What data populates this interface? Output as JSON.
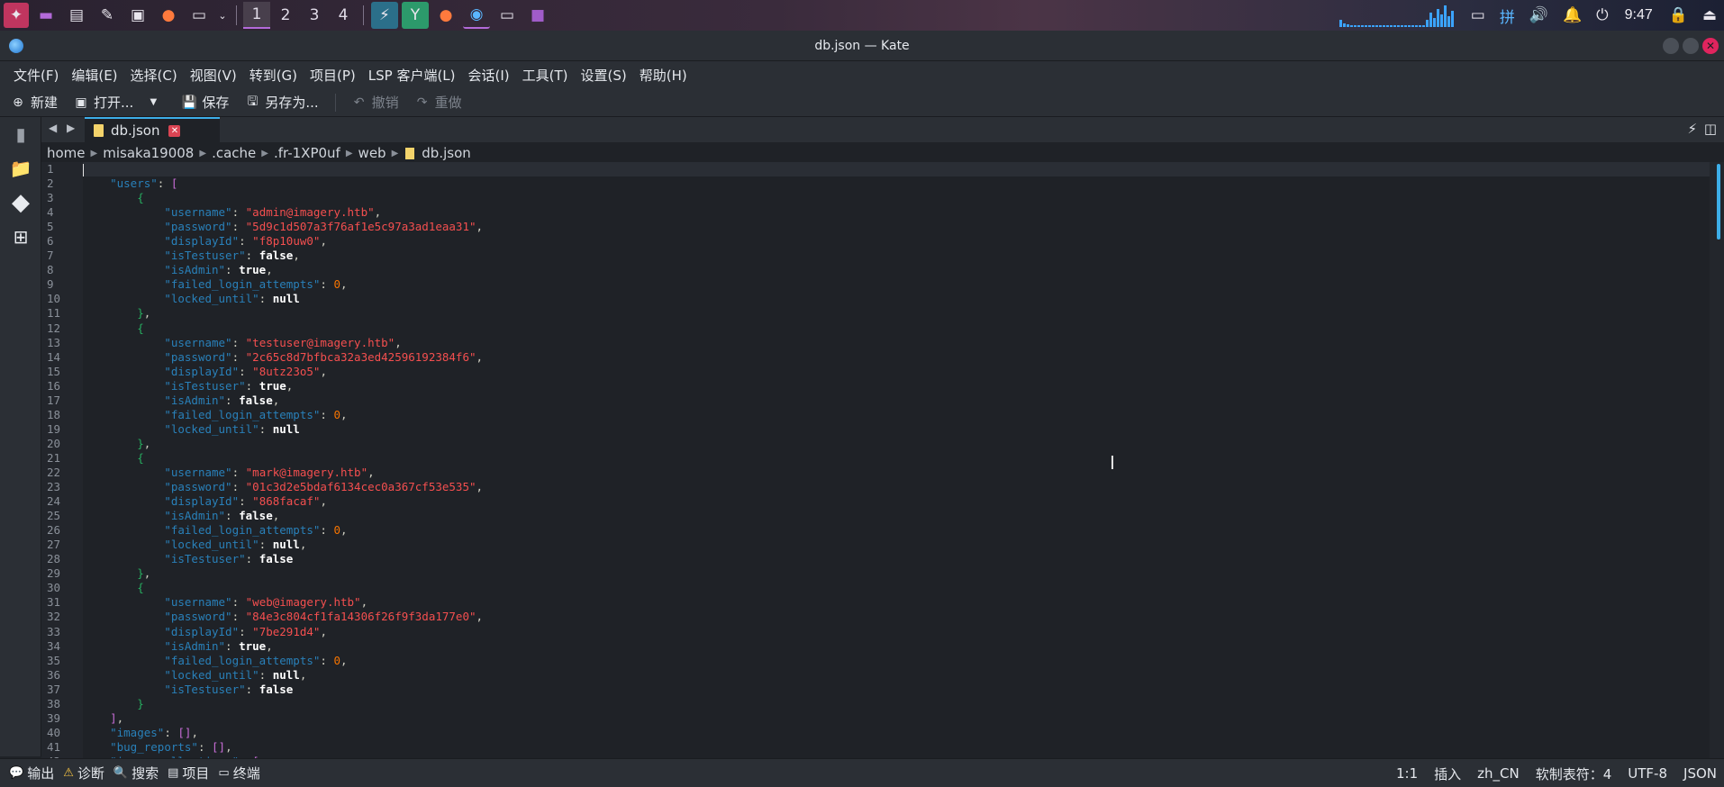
{
  "taskbar": {
    "workspaces": [
      "1",
      "2",
      "3",
      "4"
    ],
    "clock": "9:47",
    "accent": "#b36ad9"
  },
  "window": {
    "title": "db.json — Kate"
  },
  "menu": {
    "items": [
      "文件(F)",
      "编辑(E)",
      "选择(C)",
      "视图(V)",
      "转到(G)",
      "项目(P)",
      "LSP 客户端(L)",
      "会话(I)",
      "工具(T)",
      "设置(S)",
      "帮助(H)"
    ]
  },
  "toolbar": {
    "new_label": "新建",
    "open_label": "打开...",
    "save_label": "保存",
    "saveas_label": "另存为...",
    "undo_label": "撤销",
    "redo_label": "重做"
  },
  "tab": {
    "label": "db.json"
  },
  "breadcrumb": {
    "parts": [
      "home",
      "misaka19008",
      ".cache",
      ".fr-1XP0uf",
      "web"
    ],
    "file": "db.json"
  },
  "editor": {
    "users": [
      {
        "username": "admin@imagery.htb",
        "password": "5d9c1d507a3f76af1e5c97a3ad1eaa31",
        "displayId": "f8p10uw0",
        "isTestuser": "false",
        "isAdmin": "true",
        "failed_login_attempts": "0",
        "locked_until": "null"
      },
      {
        "username": "testuser@imagery.htb",
        "password": "2c65c8d7bfbca32a3ed42596192384f6",
        "displayId": "8utz23o5",
        "isTestuser": "true",
        "isAdmin": "false",
        "failed_login_attempts": "0",
        "locked_until": "null"
      },
      {
        "username": "mark@imagery.htb",
        "password": "01c3d2e5bdaf6134cec0a367cf53e535",
        "displayId": "868facaf",
        "isAdmin": "false",
        "failed_login_attempts": "0",
        "locked_until": "null",
        "isTestuser": "false"
      },
      {
        "username": "web@imagery.htb",
        "password": "84e3c804cf1fa14306f26f9f3da177e0",
        "displayId": "7be291d4",
        "isAdmin": "true",
        "failed_login_attempts": "0",
        "locked_until": "null",
        "isTestuser": "false"
      }
    ],
    "colors": {
      "key": "#2980b9",
      "string": "#f44f4f",
      "number": "#f67400",
      "bracket": "#c86dd7"
    }
  },
  "statusbar": {
    "output": "输出",
    "diagnostics": "诊断",
    "search": "搜索",
    "project": "项目",
    "terminal": "终端",
    "position": "1:1",
    "mode": "插入",
    "language": "zh_CN",
    "tabs": "软制表符：4",
    "encoding": "UTF-8",
    "filetype": "JSON"
  }
}
